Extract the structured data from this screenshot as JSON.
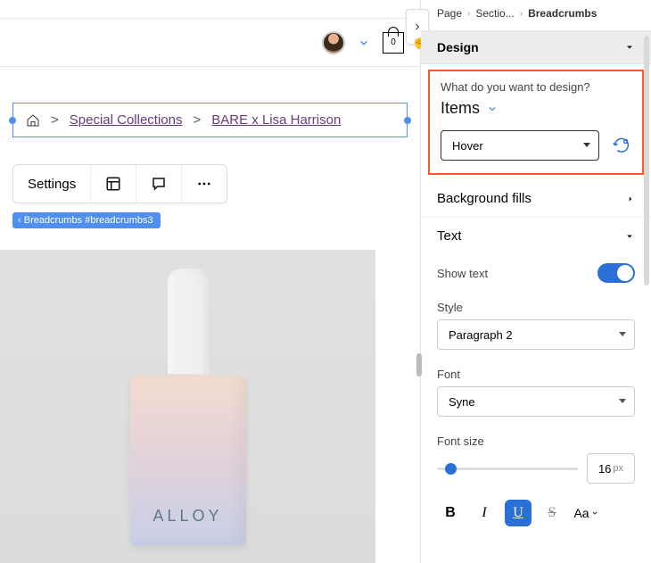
{
  "canvas": {
    "avatar_label": "User avatar",
    "bag_count": "0",
    "breadcrumbs": {
      "home_label": "Home",
      "items": [
        "Special Collections",
        "BARE x Lisa Harrison"
      ]
    },
    "toolbar": {
      "settings": "Settings"
    },
    "selection_tag": "Breadcrumbs #breadcrumbs3",
    "product_brand": "ALLOY"
  },
  "panel": {
    "crumbs": {
      "page": "Page",
      "section": "Sectio...",
      "current": "Breadcrumbs"
    },
    "sections": {
      "design": "Design",
      "background_fills": "Background fills",
      "text": "Text"
    },
    "design_box": {
      "question": "What do you want to design?",
      "target": "Items",
      "state": "Hover"
    },
    "text_section": {
      "show_text_label": "Show text",
      "style_label": "Style",
      "style_value": "Paragraph 2",
      "font_label": "Font",
      "font_value": "Syne",
      "fontsize_label": "Font size",
      "fontsize_value": "16",
      "fontsize_unit": "px",
      "format": {
        "bold": "B",
        "italic": "I",
        "underline": "U",
        "strike": "S",
        "case": "Aa"
      }
    }
  }
}
